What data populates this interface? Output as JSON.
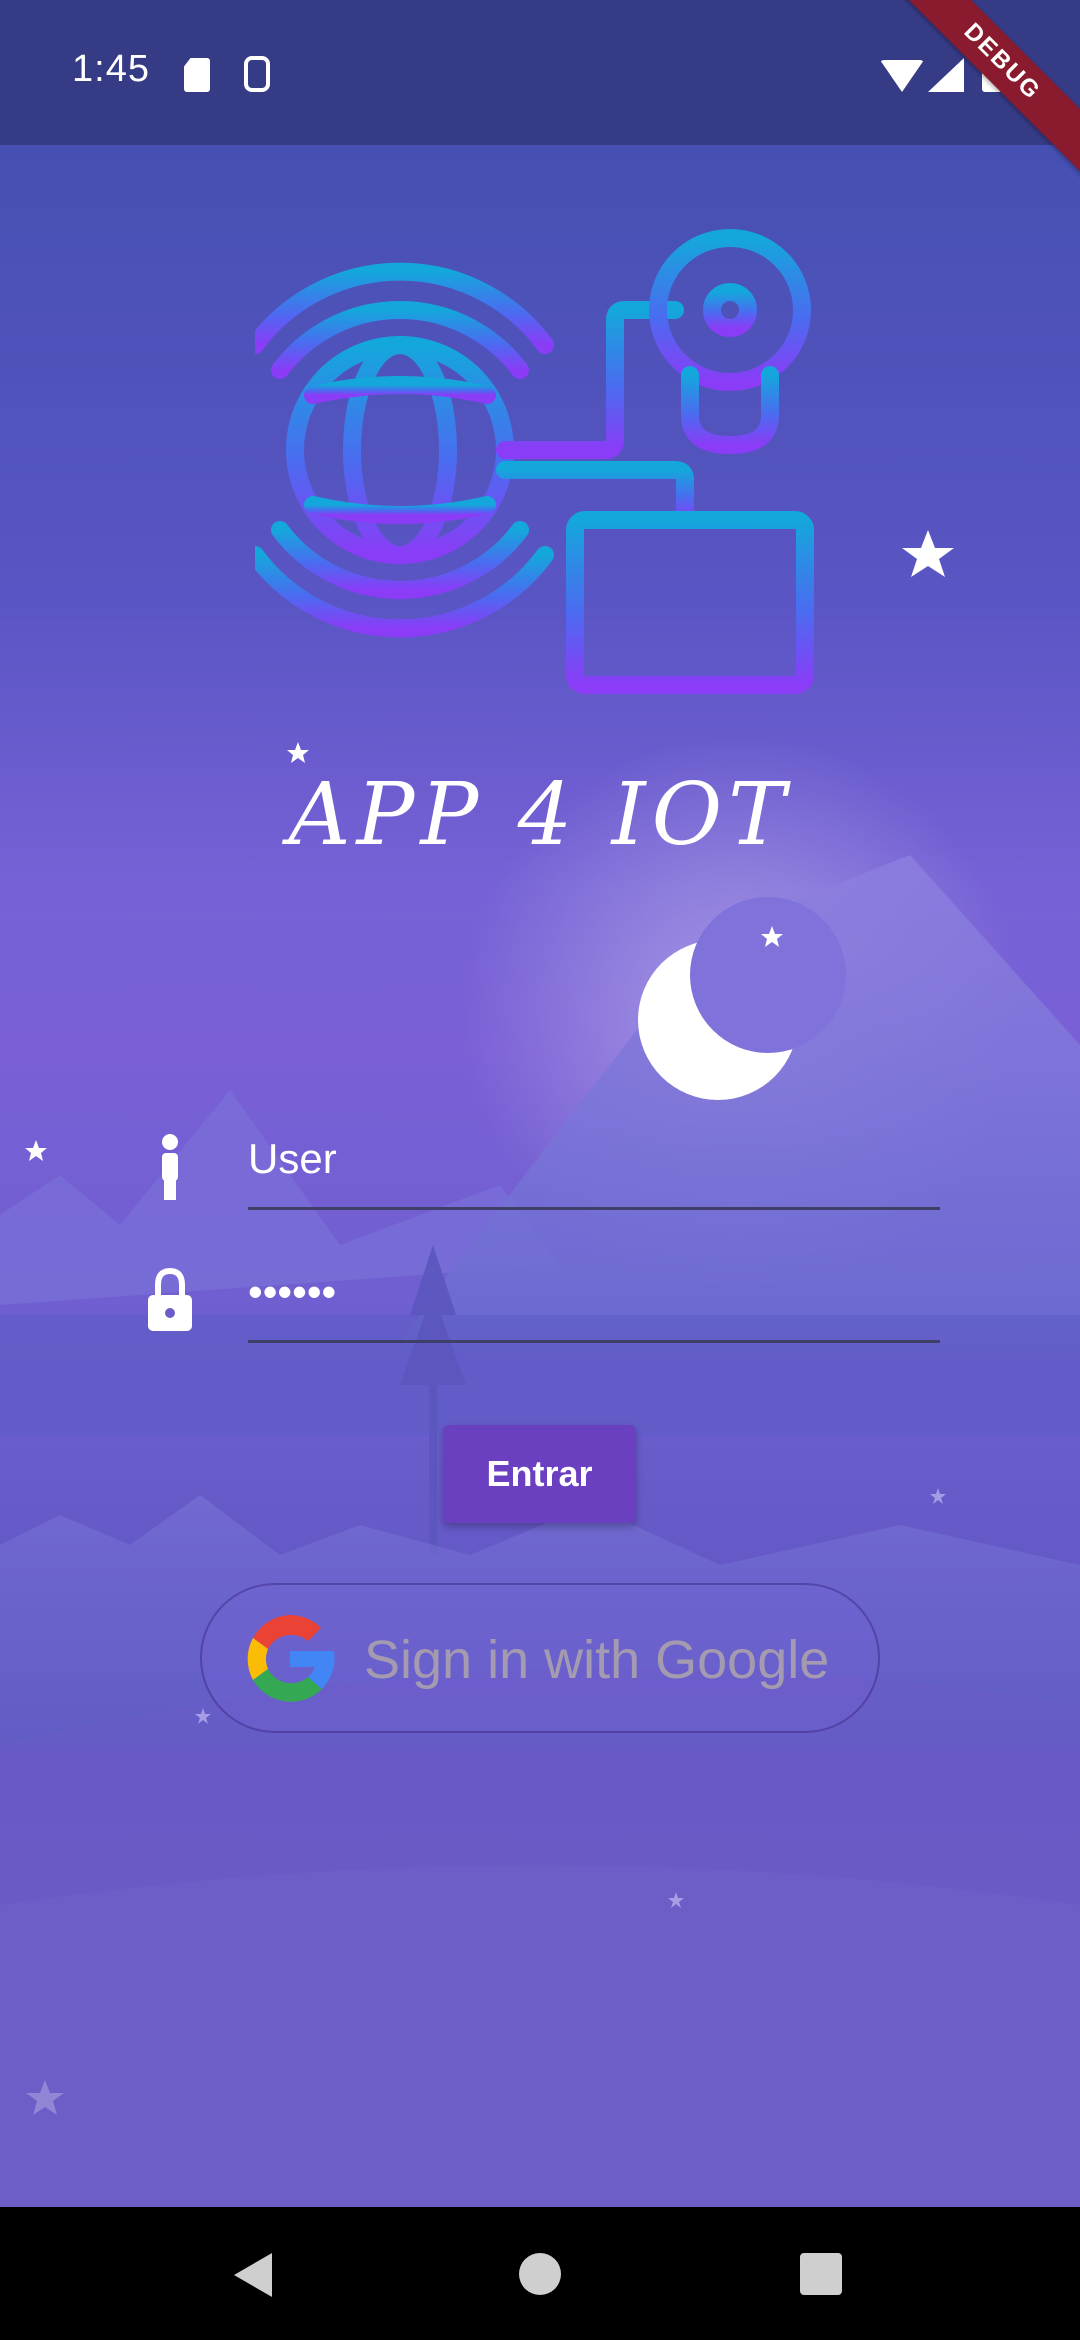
{
  "status_bar": {
    "time": "1:45"
  },
  "debug_banner": {
    "label": "DEBUG"
  },
  "app": {
    "title": "APP 4 IOT"
  },
  "login_form": {
    "user_field": {
      "value": "User"
    },
    "password_field": {
      "value": "••••••"
    },
    "submit_label": "Entrar"
  },
  "google_signin": {
    "label": "Sign in with Google"
  },
  "colors": {
    "status_bar": "#363b86",
    "button": "#6a3fc0",
    "background_top": "#4650b2",
    "background_mid": "#7a5fd6",
    "logo_gradient_top": "#14a7dc",
    "logo_gradient_bottom": "#8a3cf6"
  },
  "icons": [
    "sd-card-icon",
    "sim-icon",
    "wifi-icon",
    "signal-icon",
    "battery-icon",
    "person-icon",
    "lock-icon",
    "google-logo",
    "back-icon",
    "home-icon",
    "recents-icon"
  ]
}
